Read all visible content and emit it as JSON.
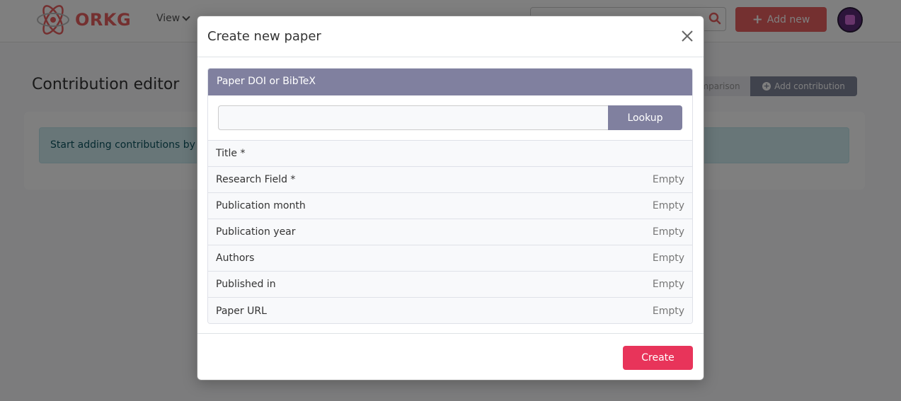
{
  "navbar": {
    "logo_text": "ORKG",
    "view_label": "View",
    "add_new_label": "Add new",
    "brand_color": "#e86161"
  },
  "page": {
    "title": "Contribution editor",
    "comparison_label": "mparison",
    "add_contribution_label": "Add contribution",
    "info_text": "Start adding contributions by cli"
  },
  "modal": {
    "title": "Create new paper",
    "panel_header": "Paper DOI or BibTeX",
    "doi_value": "",
    "lookup_label": "Lookup",
    "fields": [
      {
        "label": "Title *",
        "value": ""
      },
      {
        "label": "Research Field *",
        "value": "Empty"
      },
      {
        "label": "Publication month",
        "value": "Empty"
      },
      {
        "label": "Publication year",
        "value": "Empty"
      },
      {
        "label": "Authors",
        "value": "Empty"
      },
      {
        "label": "Published in",
        "value": "Empty"
      },
      {
        "label": "Paper URL",
        "value": "Empty"
      }
    ],
    "create_label": "Create",
    "accent_color": "#e8345a",
    "panel_color": "#80809f"
  }
}
